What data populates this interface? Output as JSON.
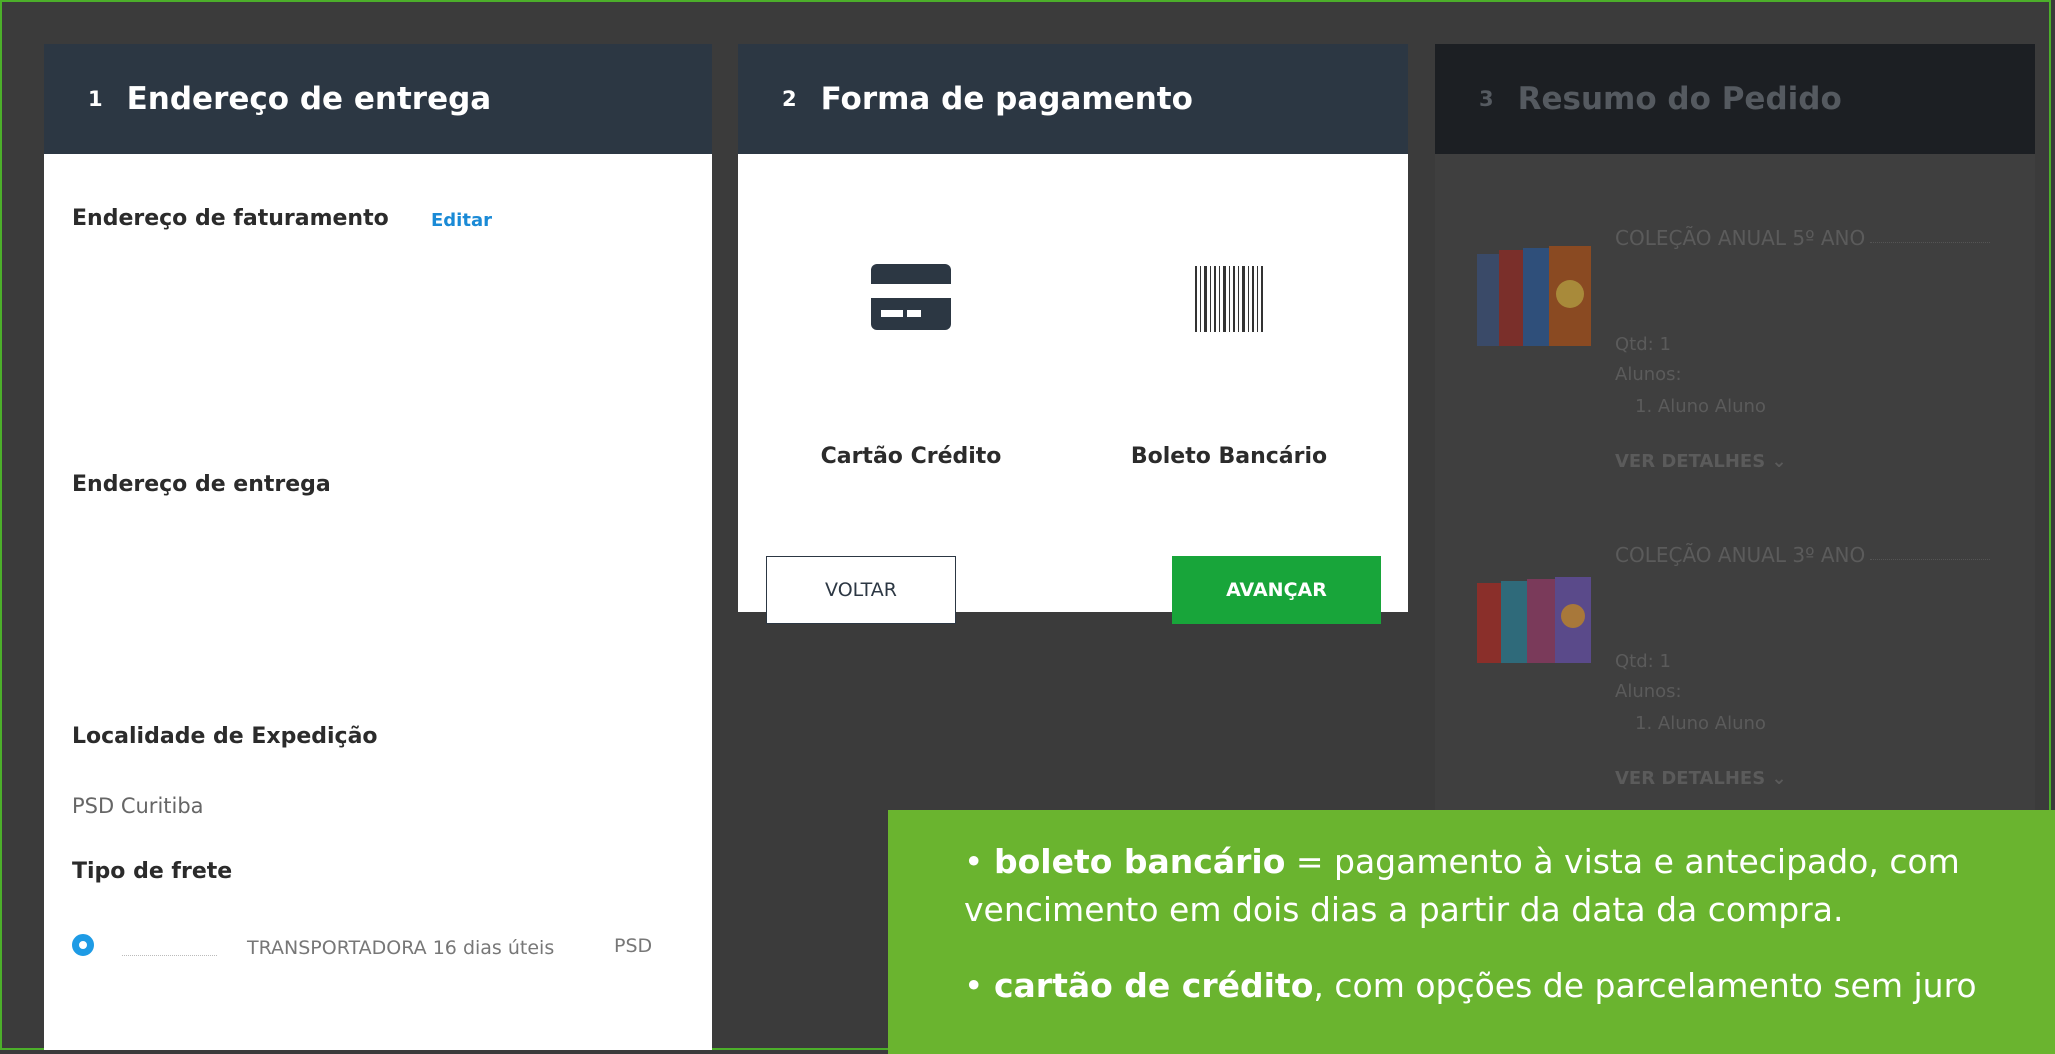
{
  "step1": {
    "number": "1",
    "title": "Endereço de entrega",
    "billing_label": "Endereço de faturamento",
    "edit_link": "Editar",
    "shipping_label": "Endereço de entrega",
    "origin_label": "Localidade de Expedição",
    "origin_value": "PSD Curitiba",
    "freight_label": "Tipo de frete",
    "freight_option": {
      "selected": true,
      "name": "TRANSPORTADORA 16 dias úteis",
      "org": "PSD"
    }
  },
  "step2": {
    "number": "2",
    "title": "Forma de pagamento",
    "methods": [
      {
        "label": "Cartão Crédito",
        "icon": "credit-card-icon"
      },
      {
        "label": "Boleto Bancário",
        "icon": "barcode-icon"
      }
    ],
    "back_label": "VOLTAR",
    "next_label": "AVANÇAR"
  },
  "step3": {
    "number": "3",
    "title": "Resumo do Pedido",
    "items": [
      {
        "title": "COLEÇÃO ANUAL 5º ANO",
        "qty": "Qtd: 1",
        "students_label": "Alunos:",
        "student": "1. Aluno Aluno",
        "details": "VER DETALHES"
      },
      {
        "title": "COLEÇÃO ANUAL 3º ANO",
        "qty": "Qtd: 1",
        "students_label": "Alunos:",
        "student": "1. Aluno Aluno",
        "details": "VER DETALHES"
      }
    ]
  },
  "info": {
    "line1_bold": "boleto bancário",
    "line1_rest": " = pagamento à vista e antecipado, com",
    "line2": "vencimento em dois dias a partir da data da compra.",
    "line3_bold": "cartão de crédito",
    "line3_rest": ", com opções de parcelamento sem juro"
  },
  "colors": {
    "header": "#2c3743",
    "primary_button": "#18a53a",
    "info_box": "#6ab42f",
    "link": "#1a8ad6",
    "radio": "#1e9be5"
  }
}
